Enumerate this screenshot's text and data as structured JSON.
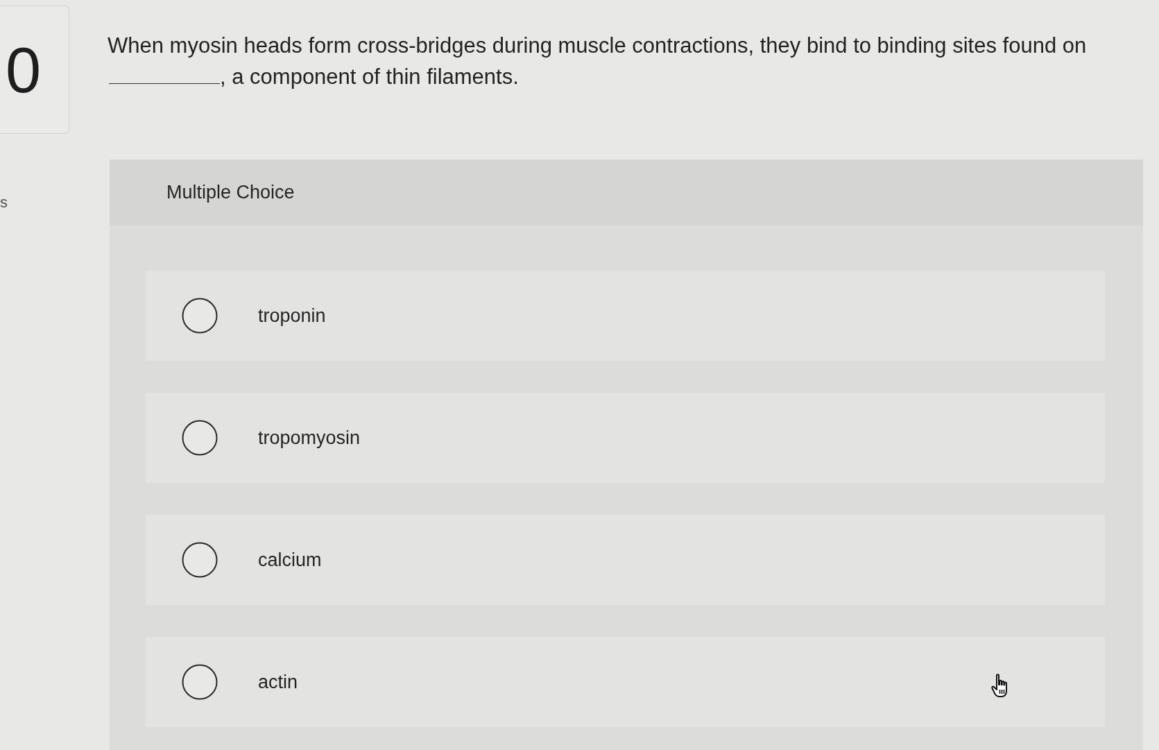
{
  "question_number": "0",
  "side_label": "s",
  "question": {
    "text_before": "When myosin heads form cross-bridges during muscle contractions, they bind to binding sites found on",
    "text_after": ", a component of thin filaments."
  },
  "answer_panel": {
    "heading": "Multiple Choice",
    "choices": [
      {
        "label": "troponin",
        "selected": false
      },
      {
        "label": "tropomyosin",
        "selected": false
      },
      {
        "label": "calcium",
        "selected": false
      },
      {
        "label": "actin",
        "selected": false
      }
    ]
  }
}
